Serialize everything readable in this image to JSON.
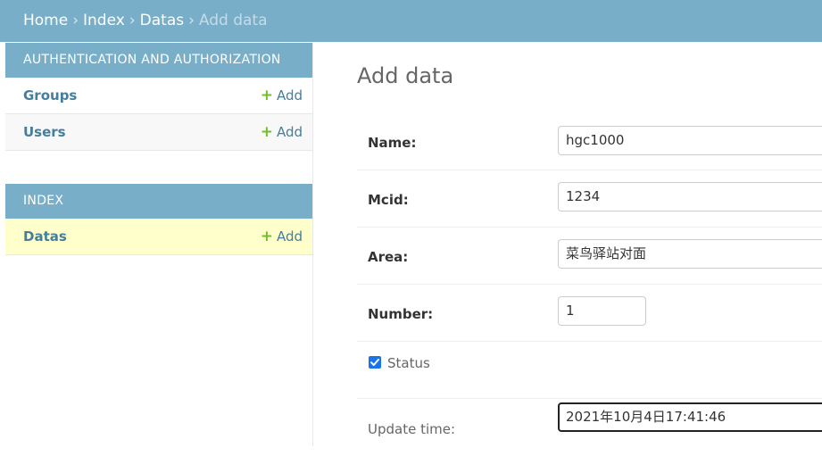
{
  "breadcrumb": {
    "home": "Home",
    "index": "Index",
    "datas": "Datas",
    "current": "Add data",
    "separator": "›"
  },
  "sidebar": {
    "modules": [
      {
        "caption": "AUTHENTICATION AND AUTHORIZATION",
        "models": [
          {
            "name": "Groups",
            "add_label": "Add"
          },
          {
            "name": "Users",
            "add_label": "Add"
          }
        ]
      },
      {
        "caption": "INDEX",
        "models": [
          {
            "name": "Datas",
            "add_label": "Add",
            "selected": true
          }
        ]
      }
    ]
  },
  "form": {
    "title": "Add data",
    "fields": {
      "name": {
        "label": "Name:",
        "value": "hgc1000"
      },
      "mcid": {
        "label": "Mcid:",
        "value": "1234"
      },
      "area": {
        "label": "Area:",
        "value": "菜鸟驿站对面"
      },
      "number": {
        "label": "Number:",
        "value": "1"
      },
      "status": {
        "label": "Status",
        "checked": true
      },
      "update_time": {
        "label": "Update time:",
        "value": "2021年10月4日17:41:46"
      }
    }
  },
  "colors": {
    "header_bg": "#79aec8",
    "link": "#447e9b",
    "add_plus": "#70bf2b",
    "selected_row": "#ffffcc",
    "checkbox": "#1a73e8"
  },
  "icons": {
    "add": "plus-icon",
    "check": "checkmark-icon"
  }
}
